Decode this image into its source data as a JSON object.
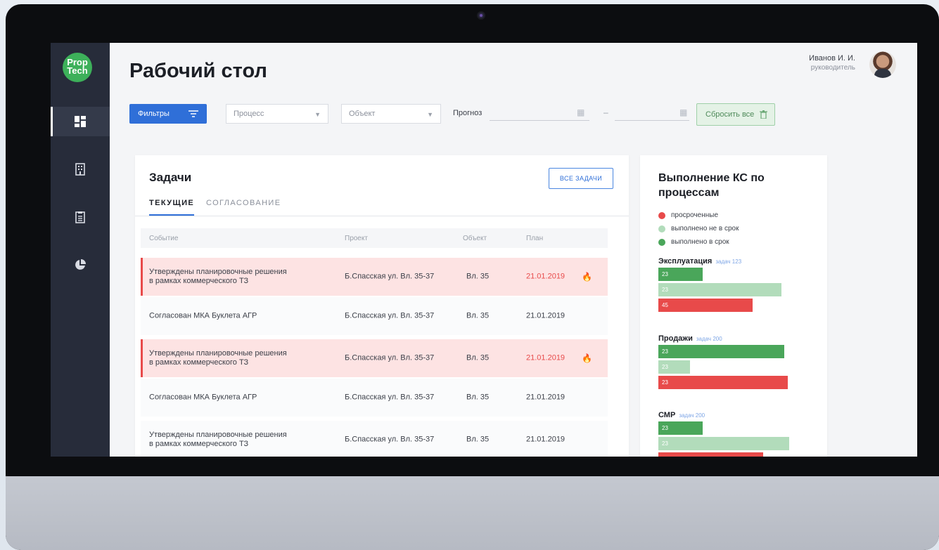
{
  "header": {
    "title": "Рабочий стол",
    "user_name": "Иванов И. И.",
    "user_role": "руководитель"
  },
  "logo": {
    "line1": "Prop",
    "line2": "Tech"
  },
  "sidebar": {
    "items": [
      {
        "icon": "dashboard-icon",
        "active": true
      },
      {
        "icon": "building-icon",
        "active": false
      },
      {
        "icon": "clipboard-icon",
        "active": false
      },
      {
        "icon": "pie-chart-icon",
        "active": false
      }
    ]
  },
  "filters": {
    "filters_label": "Фильтры",
    "process_placeholder": "Процесс",
    "object_placeholder": "Объект",
    "forecast_label": "Прогноз",
    "date_separator": "–",
    "reset_label": "Сбросить все"
  },
  "tasks": {
    "title": "Задачи",
    "all_tasks_label": "ВСЕ ЗАДАЧИ",
    "tabs": [
      "ТЕКУЩИЕ",
      "СОГЛАСОВАНИЕ"
    ],
    "columns": [
      "Событие",
      "Проект",
      "Объект",
      "План"
    ],
    "rows": [
      {
        "event_line1": "Утверждены планировочные решения",
        "event_line2": "в рамках коммерческого ТЗ",
        "project": "Б.Спасская ул. Вл. 35-37",
        "object": "Вл. 35",
        "plan": "21.01.2019",
        "overdue": true
      },
      {
        "event_line1": "Согласован МКА Буклета АГР",
        "event_line2": "",
        "project": "Б.Спасская ул. Вл. 35-37",
        "object": "Вл. 35",
        "plan": "21.01.2019",
        "overdue": false
      },
      {
        "event_line1": "Утверждены планировочные решения",
        "event_line2": "в рамках коммерческого ТЗ",
        "project": "Б.Спасская ул. Вл. 35-37",
        "object": "Вл. 35",
        "plan": "21.01.2019",
        "overdue": true
      },
      {
        "event_line1": "Согласован МКА Буклета АГР",
        "event_line2": "",
        "project": "Б.Спасская ул. Вл. 35-37",
        "object": "Вл. 35",
        "plan": "21.01.2019",
        "overdue": false
      },
      {
        "event_line1": "Утверждены планировочные решения",
        "event_line2": "в рамках коммерческого ТЗ",
        "project": "Б.Спасская ул. Вл. 35-37",
        "object": "Вл. 35",
        "plan": "21.01.2019",
        "overdue": false
      }
    ]
  },
  "ks": {
    "title": "Выполнение КС по процессам",
    "legend": [
      {
        "label": "просроченные",
        "color": "#e84a4a"
      },
      {
        "label": "выполнено не в срок",
        "color": "#b2dcbb"
      },
      {
        "label": "выполнено в срок",
        "color": "#4aa65a"
      }
    ],
    "groups": [
      {
        "name": "Эксплуатация",
        "count_label": "задач 123",
        "bars": [
          {
            "label": "23",
            "status": "on_time",
            "fraction": 0.34
          },
          {
            "label": "23",
            "status": "late",
            "fraction": 0.94
          },
          {
            "label": "45",
            "status": "overdue",
            "fraction": 0.72
          }
        ]
      },
      {
        "name": "Продажи",
        "count_label": "задач 200",
        "bars": [
          {
            "label": "23",
            "status": "on_time",
            "fraction": 0.96
          },
          {
            "label": "23",
            "status": "late",
            "fraction": 0.24
          },
          {
            "label": "23",
            "status": "overdue",
            "fraction": 0.99
          }
        ]
      },
      {
        "name": "СМР",
        "count_label": "задач 200",
        "bars": [
          {
            "label": "23",
            "status": "on_time",
            "fraction": 0.34
          },
          {
            "label": "23",
            "status": "late",
            "fraction": 1.0
          },
          {
            "label": "",
            "status": "overdue",
            "fraction": 0.8
          }
        ]
      }
    ]
  }
}
